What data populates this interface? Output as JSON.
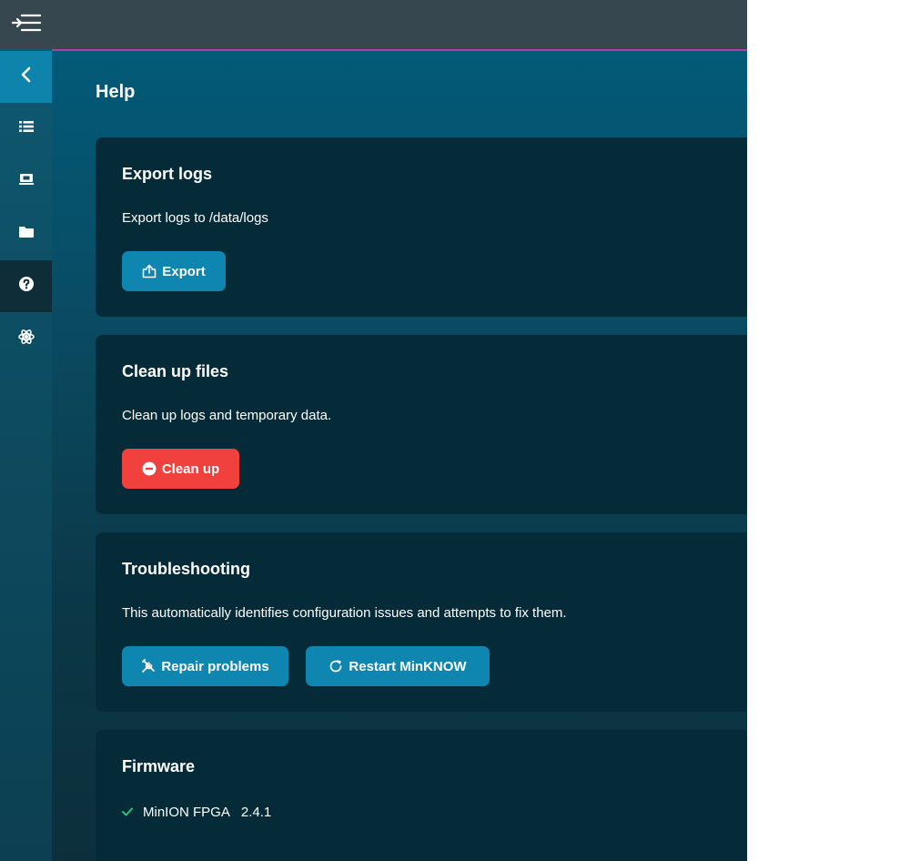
{
  "page_title": "Help",
  "sections": {
    "export": {
      "title": "Export logs",
      "description": "Export logs to /data/logs",
      "button_label": "Export"
    },
    "cleanup": {
      "title": "Clean up files",
      "description": "Clean up logs and temporary data.",
      "button_label": "Clean up"
    },
    "troubleshooting": {
      "title": "Troubleshooting",
      "description": "This automatically identifies configuration issues and attempts to fix them.",
      "repair_label": "Repair problems",
      "restart_label": "Restart MinKNOW"
    },
    "firmware": {
      "title": "Firmware",
      "items": [
        {
          "name": "MinION FPGA",
          "version": "2.4.1",
          "status": "ok"
        }
      ]
    }
  },
  "colors": {
    "accent": "#0f86b0",
    "danger": "#f0413c",
    "success": "#2ec07a",
    "topbar_line": "#b43ca8"
  },
  "sidebar": {
    "icons": [
      "menu-expand-icon",
      "chevron-left-icon",
      "list-icon",
      "device-icon",
      "folder-icon",
      "help-icon",
      "settings-icon"
    ]
  }
}
